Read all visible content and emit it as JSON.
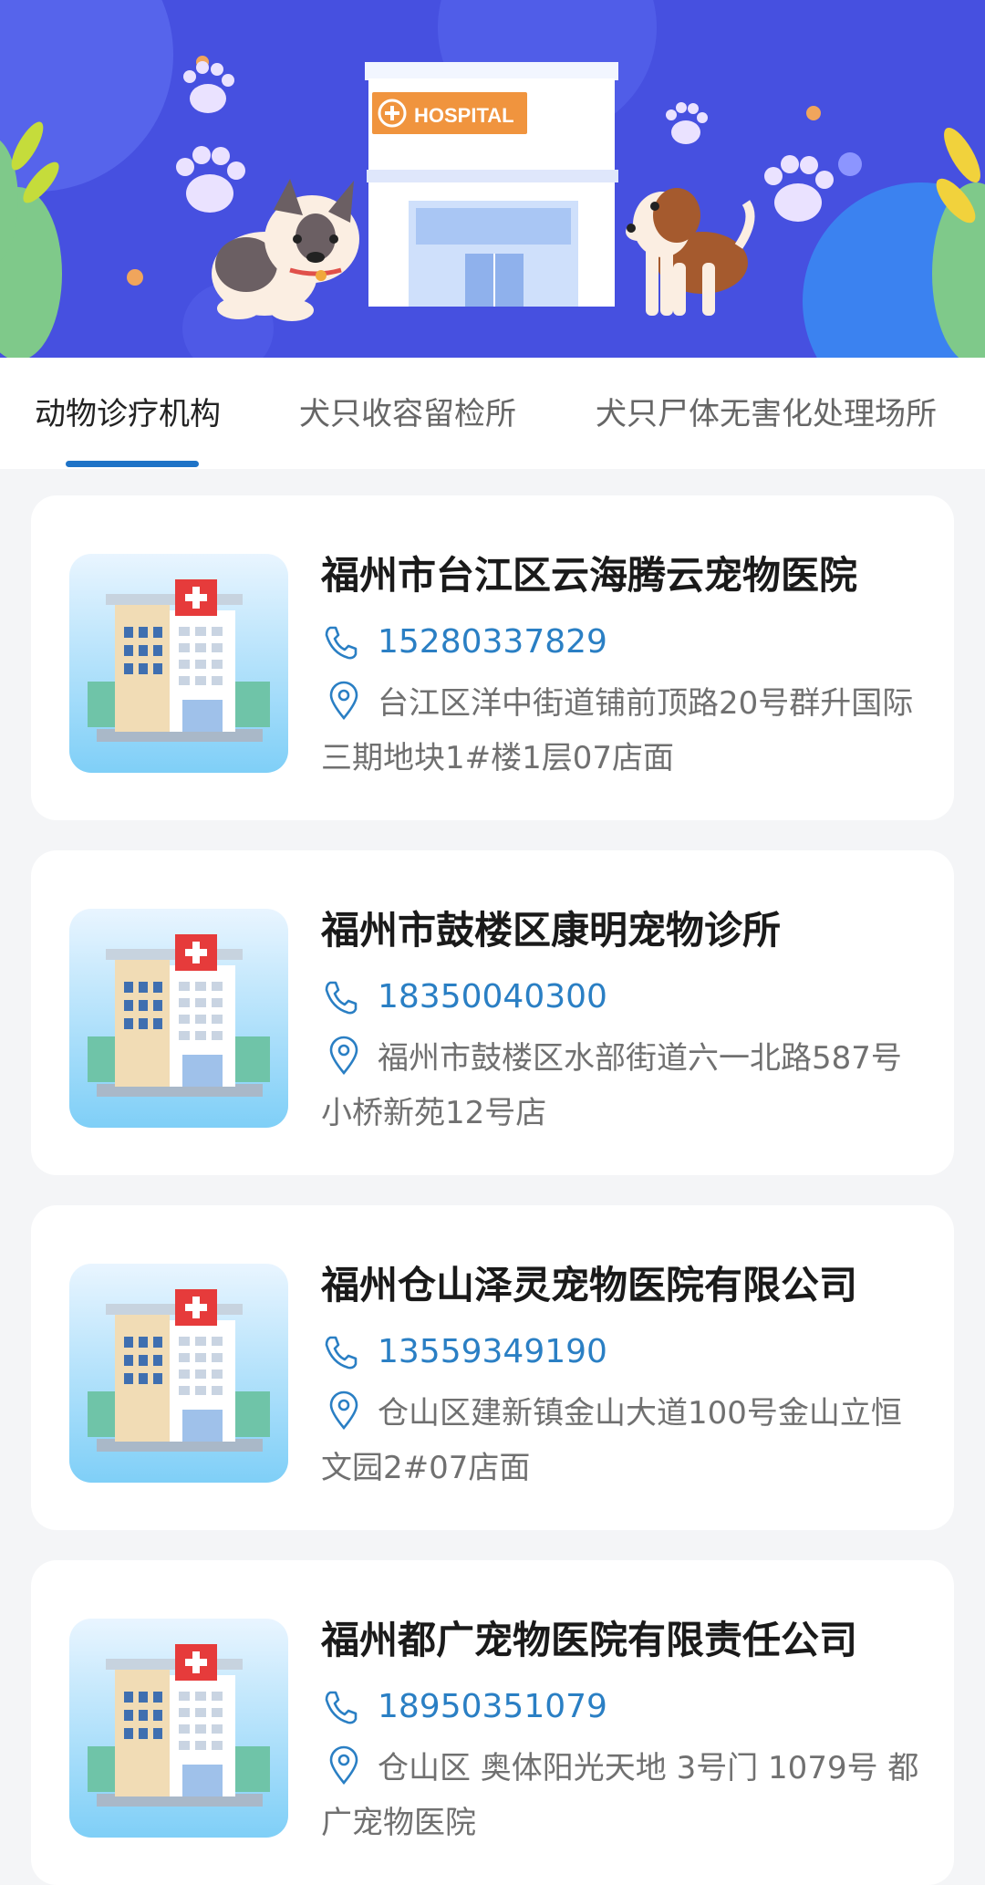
{
  "banner": {
    "hospital_sign": "HOSPITAL"
  },
  "tabs": [
    {
      "label": "动物诊疗机构",
      "active": true
    },
    {
      "label": "犬只收容留检所",
      "active": false
    },
    {
      "label": "犬只尸体无害化处理场所",
      "active": false
    }
  ],
  "clinics": [
    {
      "name": "福州市台江区云海腾云宠物医院",
      "phone": "15280337829",
      "address": "台江区洋中街道铺前顶路20号群升国际三期地块1#楼1层07店面"
    },
    {
      "name": "福州市鼓楼区康明宠物诊所",
      "phone": "18350040300",
      "address": "福州市鼓楼区水部街道六一北路587号小桥新苑12号店"
    },
    {
      "name": "福州仓山泽灵宠物医院有限公司",
      "phone": "13559349190",
      "address": "仓山区建新镇金山大道100号金山立恒文园2#07店面"
    },
    {
      "name": "福州都广宠物医院有限责任公司",
      "phone": "18950351079",
      "address": "仓山区 奥体阳光天地 3号门 1079号 都广宠物医院"
    }
  ],
  "colors": {
    "accent": "#1e73c7",
    "phone": "#2a7fc4",
    "banner_bg": "#4650e0"
  }
}
